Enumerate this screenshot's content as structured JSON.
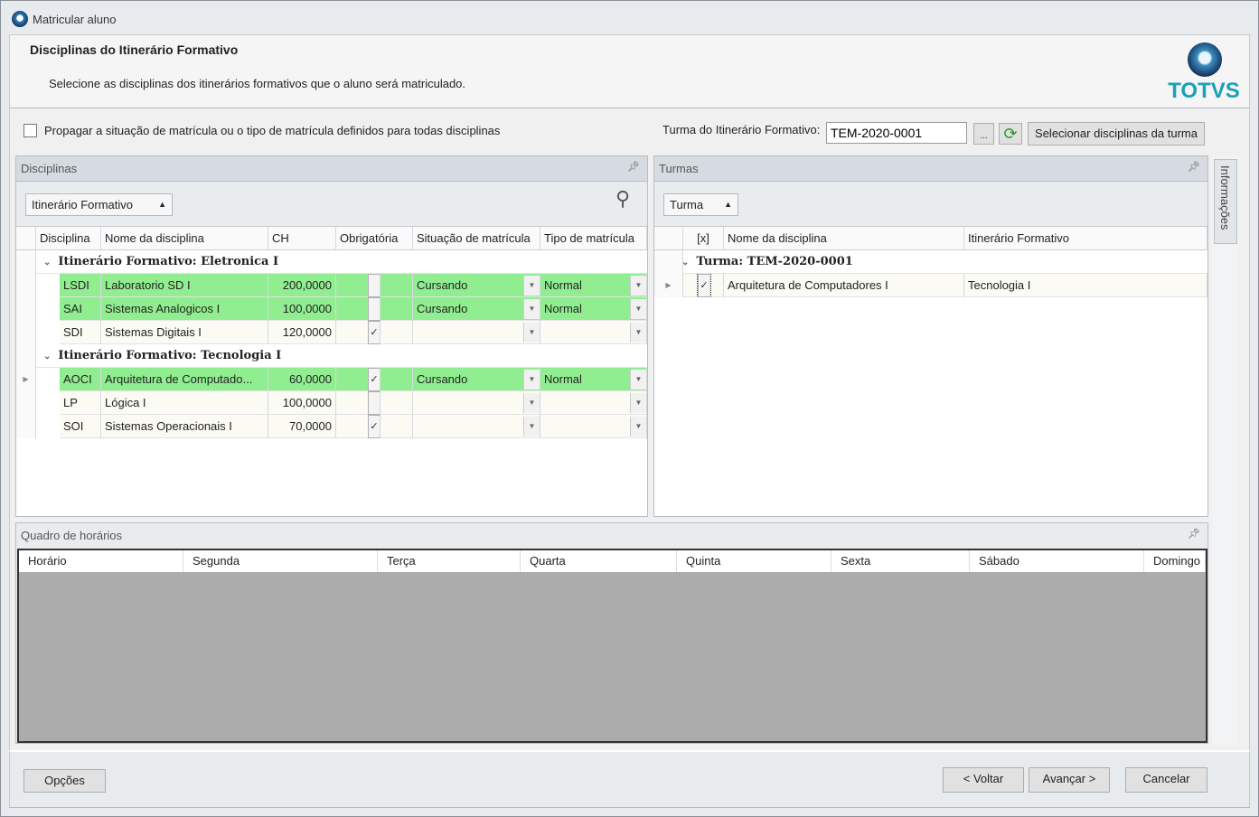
{
  "window": {
    "title": "Matricular aluno"
  },
  "header": {
    "title": "Disciplinas do Itinerário Formativo",
    "subtitle": "Selecione as disciplinas dos itinerários formativos que o aluno será matriculado.",
    "logo_text": "TOTVS"
  },
  "options": {
    "propagate_label": "Propagar a situação de matrícula ou o tipo de matrícula definidos para todas disciplinas",
    "propagate_checked": false,
    "turma_label": "Turma do Itinerário Formativo:",
    "turma_value": "TEM-2020-0001",
    "browse_label": "...",
    "select_button": "Selecionar disciplinas da turma"
  },
  "disciplinas": {
    "title": "Disciplinas",
    "group_button": "Itinerário Formativo",
    "columns": [
      "Disciplina",
      "Nome da disciplina",
      "CH",
      "Obrigatória",
      "Situação de matrícula",
      "Tipo de matrícula"
    ],
    "groups": [
      {
        "label": "Itinerário Formativo: Eletronica I",
        "rows": [
          {
            "code": "LSDI",
            "name": "Laboratorio SD I",
            "ch": "200,0000",
            "obrigatoria": false,
            "situacao": "Cursando",
            "tipo": "Normal",
            "selected": true
          },
          {
            "code": "SAI",
            "name": "Sistemas Analogicos I",
            "ch": "100,0000",
            "obrigatoria": false,
            "situacao": "Cursando",
            "tipo": "Normal",
            "selected": true
          },
          {
            "code": "SDI",
            "name": "Sistemas Digitais I",
            "ch": "120,0000",
            "obrigatoria": true,
            "situacao": "",
            "tipo": "",
            "selected": false
          }
        ]
      },
      {
        "label": "Itinerário Formativo: Tecnologia I",
        "rows": [
          {
            "code": "AOCI",
            "name": "Arquitetura de Computado...",
            "ch": "60,0000",
            "obrigatoria": true,
            "situacao": "Cursando",
            "tipo": "Normal",
            "selected": true,
            "current": true
          },
          {
            "code": "LP",
            "name": "Lógica I",
            "ch": "100,0000",
            "obrigatoria": false,
            "situacao": "",
            "tipo": "",
            "selected": false
          },
          {
            "code": "SOI",
            "name": "Sistemas Operacionais I",
            "ch": "70,0000",
            "obrigatoria": true,
            "situacao": "",
            "tipo": "",
            "selected": false
          }
        ]
      }
    ]
  },
  "turmas": {
    "title": "Turmas",
    "group_button": "Turma",
    "columns": [
      "[x]",
      "Nome da disciplina",
      "Itinerário Formativo"
    ],
    "group": "Turma: TEM-2020-0001",
    "rows": [
      {
        "checked": true,
        "name": "Arquitetura de Computadores I",
        "itinerario": "Tecnologia I"
      }
    ]
  },
  "side_tab": "Informações",
  "schedule": {
    "title": "Quadro de horários",
    "columns": [
      "Horário",
      "Segunda",
      "Terça",
      "Quarta",
      "Quinta",
      "Sexta",
      "Sábado",
      "Domingo"
    ]
  },
  "footer": {
    "options": "Opções",
    "back": "< Voltar",
    "next": "Avançar >",
    "cancel": "Cancelar"
  },
  "colors": {
    "selected_row": "#90ee90",
    "logo": "#1aa0b8"
  }
}
